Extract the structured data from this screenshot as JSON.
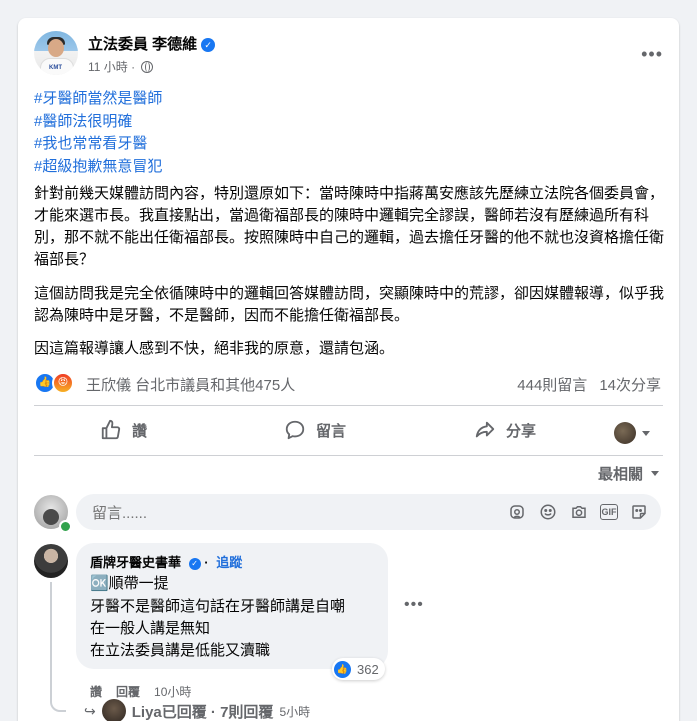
{
  "post": {
    "author": "立法委員 李德維",
    "time": "11 小時",
    "hashtags": [
      "#牙醫師當然是醫師",
      "#醫師法很明確",
      "#我也常常看牙醫",
      "#超級抱歉無意冒犯"
    ],
    "paragraphs": [
      "針對前幾天媒體訪問內容，特別還原如下：當時陳時中指蔣萬安應該先歷練立法院各個委員會，才能來選市長。我直接點出，當過衛福部長的陳時中邏輯完全謬誤，醫師若沒有歷練過所有科別，那不就不能出任衛福部長。按照陳時中自己的邏輯，過去擔任牙醫的他不就也沒資格擔任衛福部長？",
      "這個訪問我是完全依循陳時中的邏輯回答媒體訪問，突顯陳時中的荒謬，卻因媒體報導，似乎我認為陳時中是牙醫，不是醫師，因而不能擔任衛福部長。",
      "因這篇報導讓人感到不快，絕非我的原意，還請包涵。"
    ],
    "reactions_text": "王欣儀 台北市議員和其他475人",
    "comments_count": "444則留言",
    "shares_count": "14次分享"
  },
  "actions": {
    "like": "讚",
    "comment": "留言",
    "share": "分享"
  },
  "sort_label": "最相關",
  "comment_input": {
    "placeholder": "留言......"
  },
  "comment": {
    "name": "盾牌牙醫史書華",
    "follow": "追蹤",
    "lines": [
      "🆗順帶一提",
      "牙醫不是醫師這句話在牙醫師講是自嘲",
      "在一般人講是無知",
      "在立法委員講是低能又瀆職"
    ],
    "reactions": "362",
    "like": "讚",
    "reply": "回覆",
    "time": "10小時"
  },
  "reply_row": {
    "text": "Liya已回覆 · 7則回覆",
    "time": "5小時"
  },
  "colors": {
    "link": "#216fdb",
    "brand": "#1877f2",
    "muted": "#65676b"
  }
}
